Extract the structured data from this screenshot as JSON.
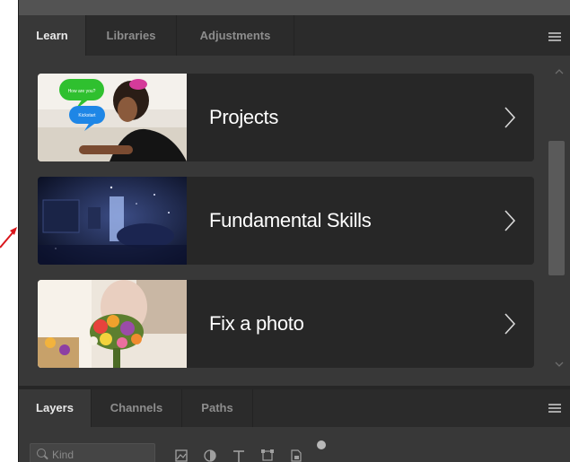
{
  "top_panel": {
    "tabs": [
      {
        "label": "Learn",
        "active": true
      },
      {
        "label": "Libraries",
        "active": false
      },
      {
        "label": "Adjustments",
        "active": false
      }
    ],
    "menu_icon": "panel-menu-icon"
  },
  "learn": {
    "cards": [
      {
        "label": "Projects",
        "thumb_icon": "projects-thumbnail",
        "bubble_1": "How are you?",
        "bubble_2": "Kickstart"
      },
      {
        "label": "Fundamental Skills",
        "thumb_icon": "fundamental-skills-thumbnail"
      },
      {
        "label": "Fix a photo",
        "thumb_icon": "fix-a-photo-thumbnail"
      }
    ]
  },
  "bottom_panel": {
    "tabs": [
      {
        "label": "Layers",
        "active": true
      },
      {
        "label": "Channels",
        "active": false
      },
      {
        "label": "Paths",
        "active": false
      }
    ],
    "kind_filter": {
      "placeholder": "Kind"
    },
    "filter_icons": [
      "pixel-layer-filter-icon",
      "adjustment-layer-filter-icon",
      "type-layer-filter-icon",
      "shape-layer-filter-icon",
      "smart-object-filter-icon",
      "filter-toggle-icon"
    ]
  },
  "colors": {
    "panel_bg": "#383838",
    "tabbar_bg": "#2b2b2b",
    "card_bg": "#272727",
    "annotation_arrow": "#d9161c"
  }
}
